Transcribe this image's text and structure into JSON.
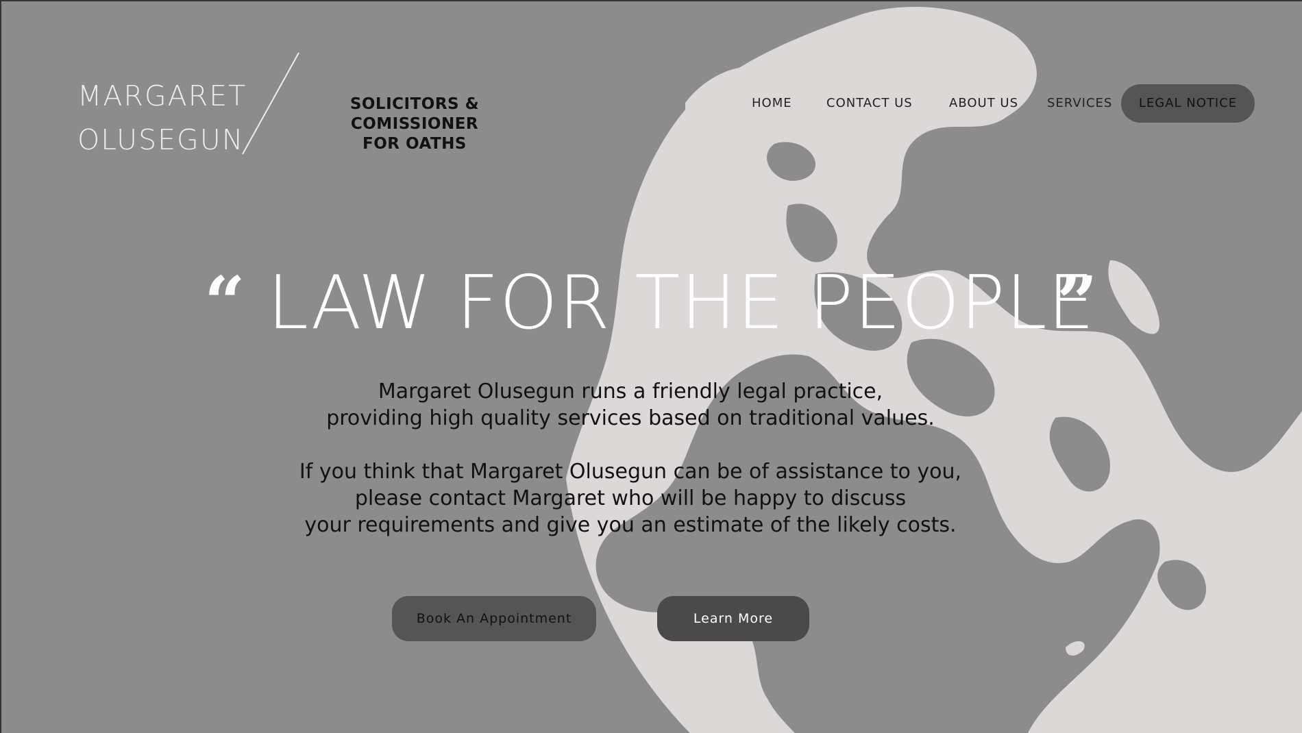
{
  "brand": {
    "name_line1": "MARGARET",
    "name_line2": "OLUSEGUN",
    "tagline_line1": "SOLICITORS & COMISSIONER",
    "tagline_line2": "FOR OATHS"
  },
  "nav": {
    "items": [
      {
        "label": "HOME"
      },
      {
        "label": "CONTACT US"
      },
      {
        "label": "ABOUT US"
      },
      {
        "label": "SERVICES"
      }
    ],
    "cta_label": "LEGAL NOTICE"
  },
  "hero": {
    "open_quote": "“",
    "headline": "LAW FOR THE PEOPLE",
    "close_quote": "”",
    "paragraph1": {
      "line1": "Margaret Olusegun runs a friendly legal practice,",
      "line2": "providing high quality services based on traditional values."
    },
    "paragraph2": {
      "line1": "If you think that Margaret Olusegun can be of assistance to you,",
      "line2": "please contact Margaret who will be happy to discuss",
      "line3": "your requirements and give you an estimate of the likely costs."
    },
    "buttons": {
      "book_label": "Book An Appointment",
      "learn_label": "Learn More"
    }
  },
  "colors": {
    "background": "#8c8c8c",
    "globe": "#dcd8d8",
    "button_dark": "#555555"
  },
  "icons": {
    "globe": "globe-illustration",
    "quotes": "quote-icon"
  }
}
